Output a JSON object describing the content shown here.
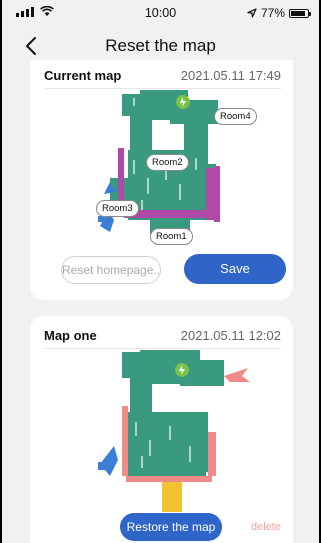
{
  "status_bar": {
    "time": "10:00",
    "battery": "77%",
    "battery_level": 0.77
  },
  "nav": {
    "title": "Reset the map"
  },
  "current_map": {
    "title": "Current map",
    "date": "2021.05.11 17:49",
    "rooms": [
      "Room4",
      "Room2",
      "Room3",
      "Room1"
    ],
    "reset_homepage_label": "Reset homepage...",
    "save_label": "Save"
  },
  "map_one": {
    "title": "Map one",
    "date": "2021.05.11 12:02",
    "restore_label": "Restore the map",
    "delete_label": "delete"
  },
  "colors": {
    "accent": "#2f64c8",
    "map_floor": "#3a9a80",
    "wall_magenta": "#b04aa8",
    "wall_pink": "#ee8a88",
    "blue_rug": "#3a7fd6",
    "yellow": "#f2c230",
    "charger_green": "#7ac24a",
    "delete_text": "#f3a3a3"
  }
}
